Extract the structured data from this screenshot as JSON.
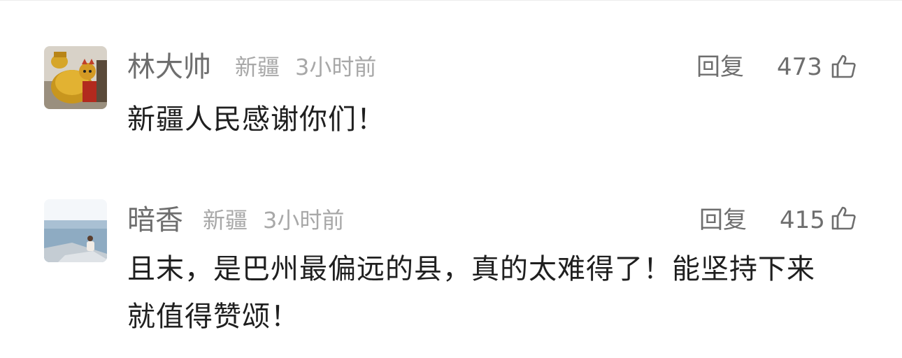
{
  "comments": [
    {
      "username": "林大帅",
      "location": "新疆",
      "time": "3小时前",
      "reply_label": "回复",
      "like_count": "473",
      "text": "新疆人民感谢你们！",
      "avatar_icon": "golden-figurine-avatar"
    },
    {
      "username": "暗香",
      "location": "新疆",
      "time": "3小时前",
      "reply_label": "回复",
      "like_count": "415",
      "text": "且末，是巴州最偏远的县，真的太难得了！能坚持下来就值得赞颂！",
      "avatar_icon": "seaside-photo-avatar"
    }
  ],
  "colors": {
    "username": "#6e6e6e",
    "meta": "#a8a8a8",
    "body_text": "#1f1f1f",
    "action": "#6e6e6e"
  }
}
